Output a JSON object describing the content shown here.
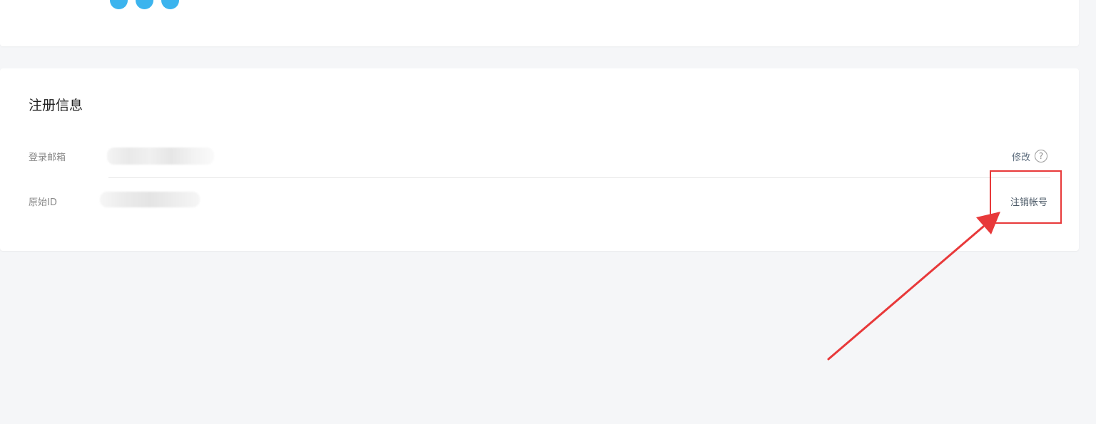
{
  "registration": {
    "title": "注册信息",
    "rows": [
      {
        "label": "登录邮箱",
        "action": "修改",
        "help": "?"
      },
      {
        "label": "原始ID",
        "action": "注销帐号"
      }
    ]
  },
  "colors": {
    "accent_blue": "#3cb4ee",
    "annotation_red": "#e8393a",
    "link": "#5b6b7c"
  },
  "icons": {
    "help": "question-circle-icon",
    "annotation": "red-arrow-icon"
  }
}
